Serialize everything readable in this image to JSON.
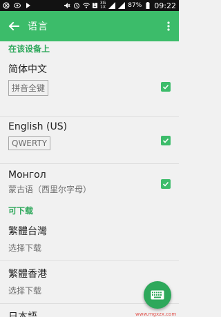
{
  "status_bar": {
    "network_badge": "1",
    "signal_3g": "3G",
    "signal_1x": "1X",
    "battery": "87%",
    "time": "09:22"
  },
  "app_bar": {
    "title": "语言"
  },
  "sections": {
    "on_device": {
      "title": "在该设备上",
      "items": [
        {
          "label": "简体中文",
          "layout_tag": "拼音全键"
        },
        {
          "label": "English (US)",
          "layout_tag": "QWERTY"
        },
        {
          "label": "Монгол",
          "subtitle": "蒙古语（西里尔字母）"
        }
      ]
    },
    "downloadable": {
      "title": "可下载",
      "items": [
        {
          "label": "繁體台灣",
          "subtitle": "选择下载"
        },
        {
          "label": "繁體香港",
          "subtitle": "选择下载"
        },
        {
          "label": "日本語"
        }
      ]
    }
  },
  "watermark": "www.mgxzx.com",
  "colors": {
    "accent": "#3cbc6a",
    "accent_dark": "#2ea85b",
    "background": "#f1f1f1"
  }
}
